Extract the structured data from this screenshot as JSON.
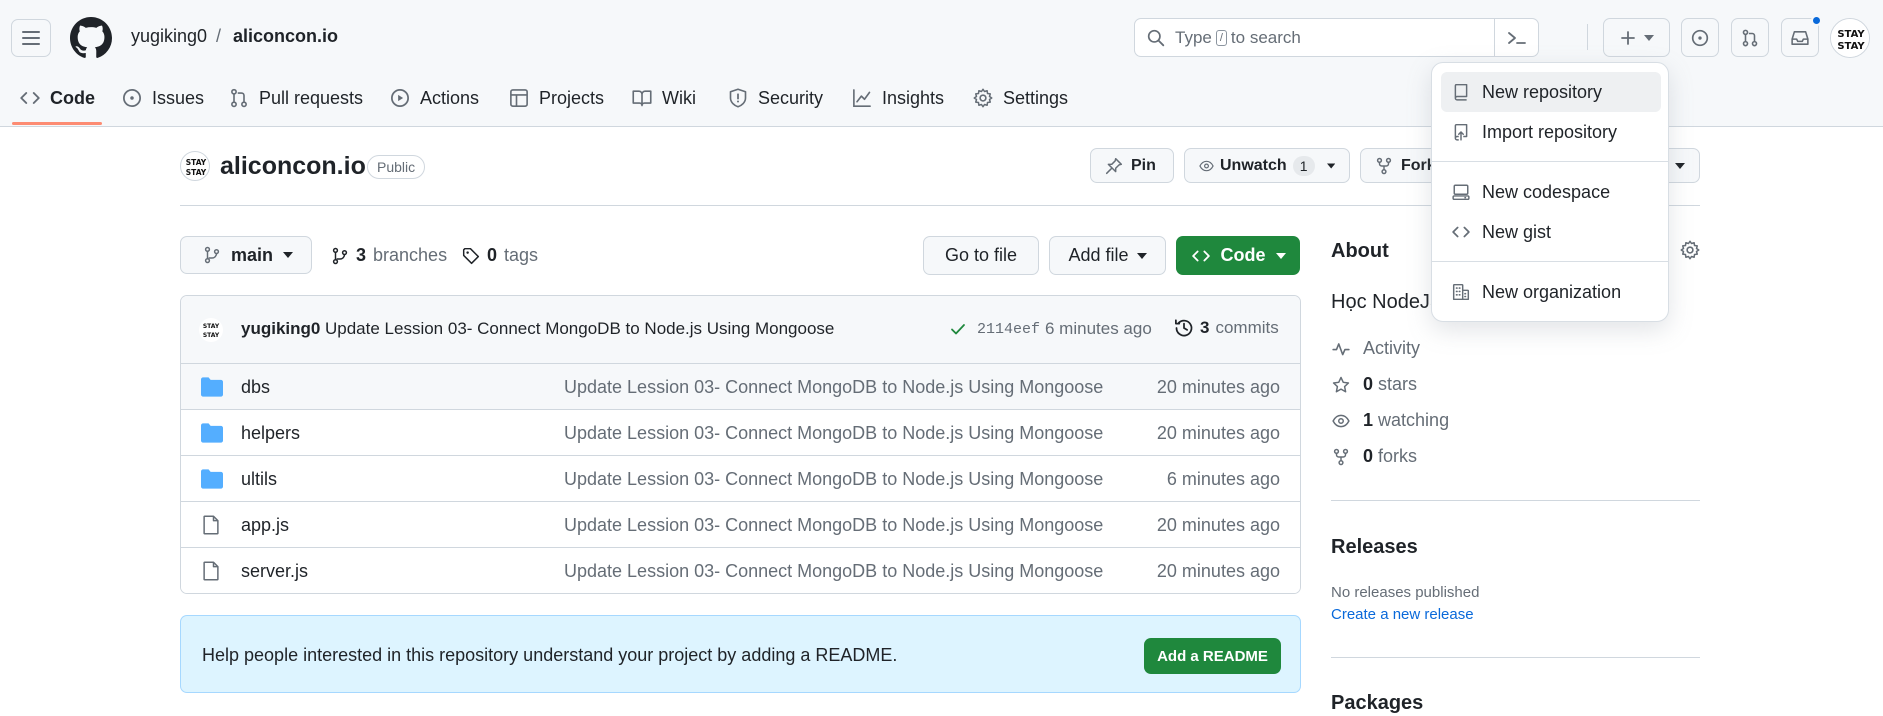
{
  "header": {
    "owner": "yugiking0",
    "separator": "/",
    "repo": "aliconcon.io",
    "search_prefix": "Type",
    "search_key": "/",
    "search_suffix": "to search"
  },
  "tabs": [
    {
      "label": "Code",
      "icon": "code-icon"
    },
    {
      "label": "Issues",
      "icon": "issue-icon"
    },
    {
      "label": "Pull requests",
      "icon": "pull-request-icon"
    },
    {
      "label": "Actions",
      "icon": "play-icon"
    },
    {
      "label": "Projects",
      "icon": "table-icon"
    },
    {
      "label": "Wiki",
      "icon": "book-icon"
    },
    {
      "label": "Security",
      "icon": "shield-icon"
    },
    {
      "label": "Insights",
      "icon": "graph-icon"
    },
    {
      "label": "Settings",
      "icon": "gear-icon"
    }
  ],
  "repo_header": {
    "title": "aliconcon.io",
    "visibility": "Public",
    "pin_label": "Pin",
    "unwatch_label": "Unwatch",
    "watch_count": "1",
    "fork_label": "Fork"
  },
  "branch_bar": {
    "branch": "main",
    "branches_count": "3",
    "branches_label": "branches",
    "tags_count": "0",
    "tags_label": "tags",
    "go_to_file": "Go to file",
    "add_file": "Add file",
    "code_label": "Code"
  },
  "latest_commit": {
    "author": "yugiking0",
    "message": "Update Lession 03- Connect MongoDB to Node.js Using Mongoose",
    "sha": "2114eef",
    "time": "6 minutes ago",
    "commit_count": "3",
    "commits_label": "commits"
  },
  "files": [
    {
      "name": "dbs",
      "type": "folder",
      "message": "Update Lession 03- Connect MongoDB to Node.js Using Mongoose",
      "time": "20 minutes ago"
    },
    {
      "name": "helpers",
      "type": "folder",
      "message": "Update Lession 03- Connect MongoDB to Node.js Using Mongoose",
      "time": "20 minutes ago"
    },
    {
      "name": "ultils",
      "type": "folder",
      "message": "Update Lession 03- Connect MongoDB to Node.js Using Mongoose",
      "time": "6 minutes ago"
    },
    {
      "name": "app.js",
      "type": "file",
      "message": "Update Lession 03- Connect MongoDB to Node.js Using Mongoose",
      "time": "20 minutes ago"
    },
    {
      "name": "server.js",
      "type": "file",
      "message": "Update Lession 03- Connect MongoDB to Node.js Using Mongoose",
      "time": "20 minutes ago"
    }
  ],
  "readme_banner": {
    "text": "Help people interested in this repository understand your project by adding a README.",
    "button": "Add a README"
  },
  "sidebar": {
    "about_title": "About",
    "description": "Học NodeJS",
    "activity": "Activity",
    "stars_count": "0",
    "stars_label": "stars",
    "watching_count": "1",
    "watching_label": "watching",
    "forks_count": "0",
    "forks_label": "forks",
    "releases_title": "Releases",
    "no_releases": "No releases published",
    "create_release": "Create a new release",
    "packages_title": "Packages"
  },
  "create_menu": {
    "items": [
      {
        "label": "New repository",
        "icon": "repo-icon"
      },
      {
        "label": "Import repository",
        "icon": "repo-push-icon"
      },
      {
        "label": "New codespace",
        "icon": "codespaces-icon"
      },
      {
        "label": "New gist",
        "icon": "code-icon"
      },
      {
        "label": "New organization",
        "icon": "organization-icon"
      }
    ]
  },
  "avatar_text": "STAY STAY",
  "colors": {
    "accent_green": "#1f883d",
    "link_blue": "#0969da",
    "folder_blue": "#54aeff",
    "tab_underline": "#fd8c73",
    "readme_bg": "#ddf4ff"
  }
}
